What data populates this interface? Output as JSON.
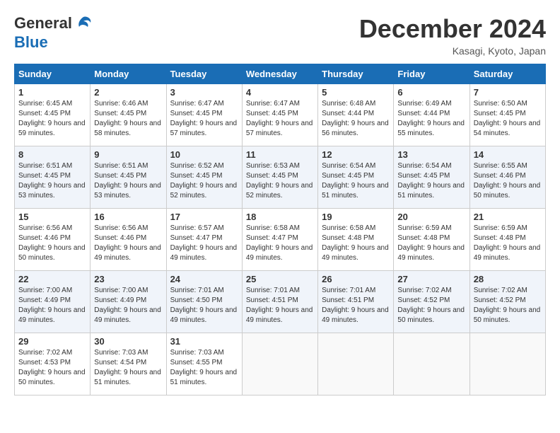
{
  "header": {
    "logo_line1": "General",
    "logo_line2": "Blue",
    "month_title": "December 2024",
    "location": "Kasagi, Kyoto, Japan"
  },
  "weekdays": [
    "Sunday",
    "Monday",
    "Tuesday",
    "Wednesday",
    "Thursday",
    "Friday",
    "Saturday"
  ],
  "weeks": [
    [
      {
        "day": "1",
        "sunrise": "6:45 AM",
        "sunset": "4:45 PM",
        "daylight": "9 hours and 59 minutes."
      },
      {
        "day": "2",
        "sunrise": "6:46 AM",
        "sunset": "4:45 PM",
        "daylight": "9 hours and 58 minutes."
      },
      {
        "day": "3",
        "sunrise": "6:47 AM",
        "sunset": "4:45 PM",
        "daylight": "9 hours and 57 minutes."
      },
      {
        "day": "4",
        "sunrise": "6:47 AM",
        "sunset": "4:45 PM",
        "daylight": "9 hours and 57 minutes."
      },
      {
        "day": "5",
        "sunrise": "6:48 AM",
        "sunset": "4:44 PM",
        "daylight": "9 hours and 56 minutes."
      },
      {
        "day": "6",
        "sunrise": "6:49 AM",
        "sunset": "4:44 PM",
        "daylight": "9 hours and 55 minutes."
      },
      {
        "day": "7",
        "sunrise": "6:50 AM",
        "sunset": "4:45 PM",
        "daylight": "9 hours and 54 minutes."
      }
    ],
    [
      {
        "day": "8",
        "sunrise": "6:51 AM",
        "sunset": "4:45 PM",
        "daylight": "9 hours and 53 minutes."
      },
      {
        "day": "9",
        "sunrise": "6:51 AM",
        "sunset": "4:45 PM",
        "daylight": "9 hours and 53 minutes."
      },
      {
        "day": "10",
        "sunrise": "6:52 AM",
        "sunset": "4:45 PM",
        "daylight": "9 hours and 52 minutes."
      },
      {
        "day": "11",
        "sunrise": "6:53 AM",
        "sunset": "4:45 PM",
        "daylight": "9 hours and 52 minutes."
      },
      {
        "day": "12",
        "sunrise": "6:54 AM",
        "sunset": "4:45 PM",
        "daylight": "9 hours and 51 minutes."
      },
      {
        "day": "13",
        "sunrise": "6:54 AM",
        "sunset": "4:45 PM",
        "daylight": "9 hours and 51 minutes."
      },
      {
        "day": "14",
        "sunrise": "6:55 AM",
        "sunset": "4:46 PM",
        "daylight": "9 hours and 50 minutes."
      }
    ],
    [
      {
        "day": "15",
        "sunrise": "6:56 AM",
        "sunset": "4:46 PM",
        "daylight": "9 hours and 50 minutes."
      },
      {
        "day": "16",
        "sunrise": "6:56 AM",
        "sunset": "4:46 PM",
        "daylight": "9 hours and 49 minutes."
      },
      {
        "day": "17",
        "sunrise": "6:57 AM",
        "sunset": "4:47 PM",
        "daylight": "9 hours and 49 minutes."
      },
      {
        "day": "18",
        "sunrise": "6:58 AM",
        "sunset": "4:47 PM",
        "daylight": "9 hours and 49 minutes."
      },
      {
        "day": "19",
        "sunrise": "6:58 AM",
        "sunset": "4:48 PM",
        "daylight": "9 hours and 49 minutes."
      },
      {
        "day": "20",
        "sunrise": "6:59 AM",
        "sunset": "4:48 PM",
        "daylight": "9 hours and 49 minutes."
      },
      {
        "day": "21",
        "sunrise": "6:59 AM",
        "sunset": "4:48 PM",
        "daylight": "9 hours and 49 minutes."
      }
    ],
    [
      {
        "day": "22",
        "sunrise": "7:00 AM",
        "sunset": "4:49 PM",
        "daylight": "9 hours and 49 minutes."
      },
      {
        "day": "23",
        "sunrise": "7:00 AM",
        "sunset": "4:49 PM",
        "daylight": "9 hours and 49 minutes."
      },
      {
        "day": "24",
        "sunrise": "7:01 AM",
        "sunset": "4:50 PM",
        "daylight": "9 hours and 49 minutes."
      },
      {
        "day": "25",
        "sunrise": "7:01 AM",
        "sunset": "4:51 PM",
        "daylight": "9 hours and 49 minutes."
      },
      {
        "day": "26",
        "sunrise": "7:01 AM",
        "sunset": "4:51 PM",
        "daylight": "9 hours and 49 minutes."
      },
      {
        "day": "27",
        "sunrise": "7:02 AM",
        "sunset": "4:52 PM",
        "daylight": "9 hours and 50 minutes."
      },
      {
        "day": "28",
        "sunrise": "7:02 AM",
        "sunset": "4:52 PM",
        "daylight": "9 hours and 50 minutes."
      }
    ],
    [
      {
        "day": "29",
        "sunrise": "7:02 AM",
        "sunset": "4:53 PM",
        "daylight": "9 hours and 50 minutes."
      },
      {
        "day": "30",
        "sunrise": "7:03 AM",
        "sunset": "4:54 PM",
        "daylight": "9 hours and 51 minutes."
      },
      {
        "day": "31",
        "sunrise": "7:03 AM",
        "sunset": "4:55 PM",
        "daylight": "9 hours and 51 minutes."
      },
      null,
      null,
      null,
      null
    ]
  ]
}
